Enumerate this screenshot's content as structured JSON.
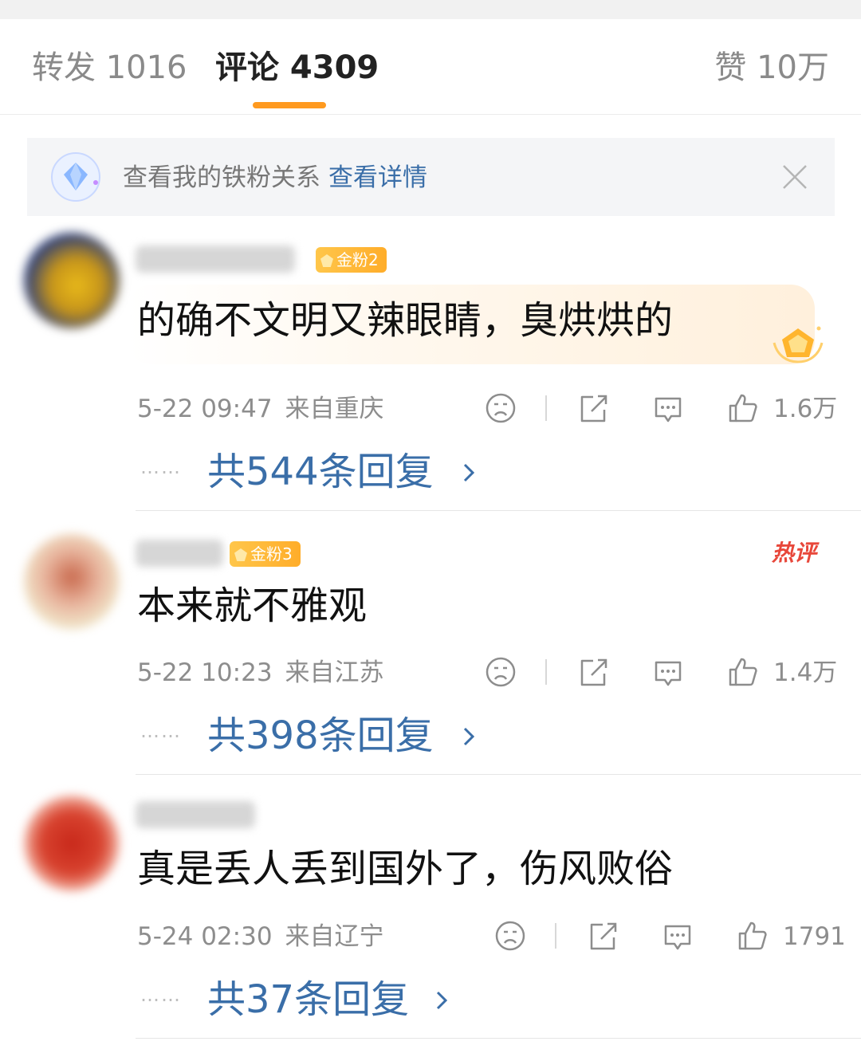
{
  "tabs": {
    "repost_label": "转发 1016",
    "comments_label": "评论 4309",
    "likes_label": "赞 10万"
  },
  "fans_banner": {
    "text": "查看我的铁粉关系",
    "link": "查看详情"
  },
  "comments": [
    {
      "badge": "金粉2",
      "text": "的确不文明又辣眼睛，臭烘烘的",
      "time": "5-22 09:47",
      "location": "来自重庆",
      "likes": "1.6万",
      "replies_dots": "……",
      "replies": "共544条回复"
    },
    {
      "badge": "金粉3",
      "hot_tag": "热评",
      "text": "本来就不雅观",
      "time": "5-22 10:23",
      "location": "来自江苏",
      "likes": "1.4万",
      "replies_dots": "……",
      "replies": "共398条回复"
    },
    {
      "text": "真是丢人丢到国外了，伤风败俗",
      "time": "5-24 02:30",
      "location": "来自辽宁",
      "likes": "1791",
      "replies_dots": "……",
      "replies": "共37条回复"
    }
  ],
  "colors": {
    "accent": "#ff9a1f",
    "link": "#3a6ea8",
    "badge": "#ffb835",
    "hot": "#e8473a"
  }
}
